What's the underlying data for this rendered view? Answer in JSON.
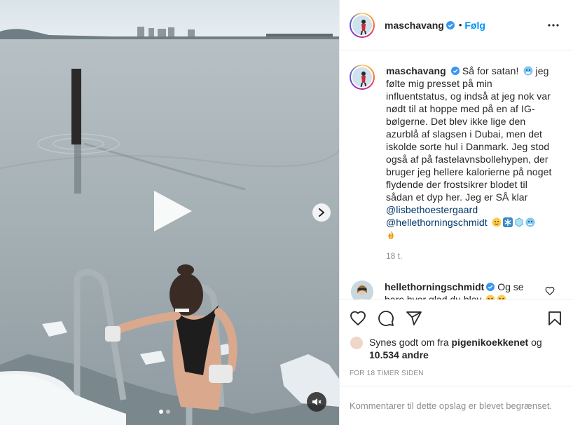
{
  "post": {
    "author": "maschavang",
    "follow_label": "Følg",
    "caption_intro": "Så for satan!",
    "caption_body": "jeg følte mig presset på min influentstatus, og indså at jeg nok var nødt til at hoppe med på en af IG-bølgerne. Det blev ikke lige den azurblå af slagsen i Dubai, men det iskolde sorte hul i Danmark. Jeg stod også af på fastelavnsbollehypen, der bruger jeg hellere kalorierne på noget flydende der frostsikrer blodet til sådan et dyp her. Jeg er SÅ klar",
    "mention_1": "@lisbethoestergaard",
    "mention_2": "@hellethorningschmidt",
    "caption_time": "18 t.",
    "caption_emojis": [
      "cold-face",
      "snowflake",
      "ice-cube",
      "cold-face",
      "fire"
    ]
  },
  "comment": {
    "author": "hellethorningschmidt",
    "text": "Og se bare hvor glad du blev",
    "emojis": [
      "grinning-squint",
      "grinning-squint"
    ]
  },
  "likes": {
    "prefix": "Synes godt om fra",
    "liker": "pigenikoekkenet",
    "conj": "og",
    "others": "10.534 andre"
  },
  "timestamp": "FOR 18 TIMER SIDEN",
  "comments_disabled": "Kommentarer til dette opslag er blevet begrænset.",
  "colors": {
    "link": "#0095f6",
    "mention": "#00376b",
    "secondary": "#8e8e8e",
    "verified": "#3897f0"
  }
}
